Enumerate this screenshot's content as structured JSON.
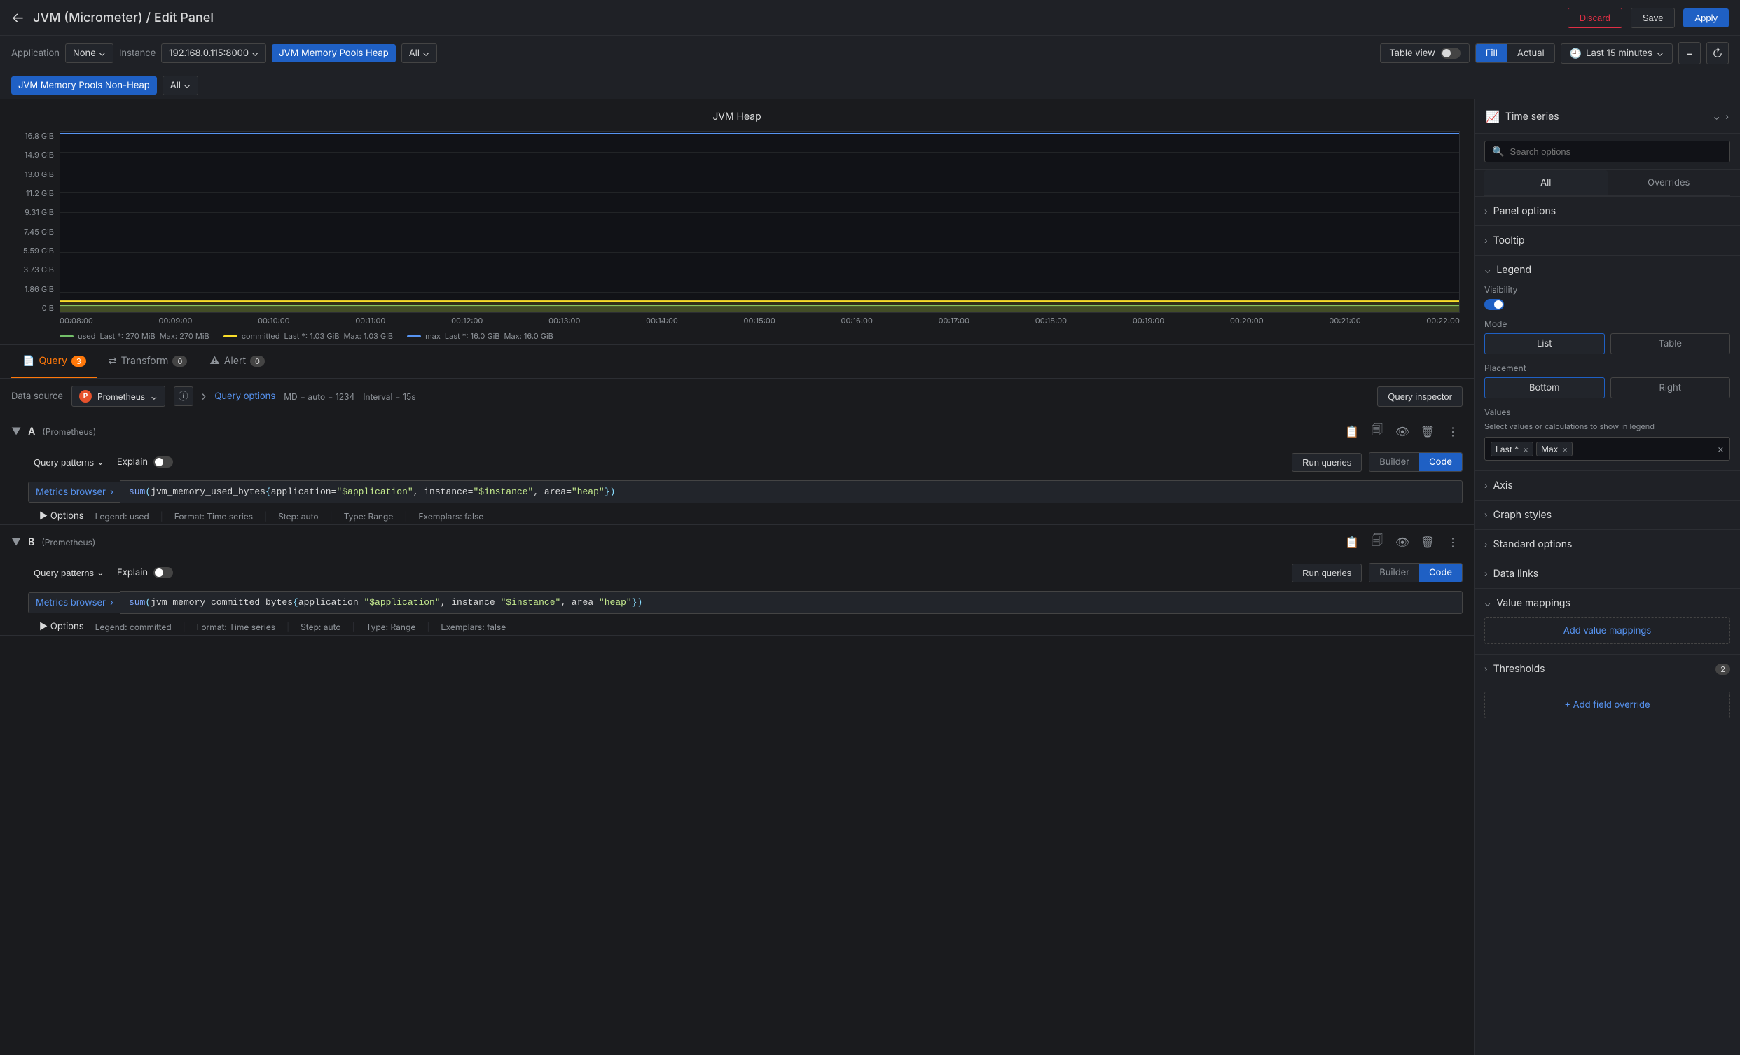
{
  "topbar": {
    "title": "JVM (Micrometer) / Edit Panel",
    "discard_label": "Discard",
    "save_label": "Save",
    "apply_label": "Apply"
  },
  "filterbar": {
    "application_label": "Application",
    "application_value": "None",
    "instance_label": "Instance",
    "instance_value": "192.168.0.115:8000",
    "memory_pools_heap_label": "JVM Memory Pools Heap",
    "memory_pools_heap_value": "All",
    "table_view_label": "Table view",
    "fill_label": "Fill",
    "actual_label": "Actual",
    "time_label": "Last 15 minutes",
    "memory_pools_nonheap_label": "JVM Memory Pools Non-Heap",
    "memory_pools_nonheap_value": "All"
  },
  "chart": {
    "title": "JVM Heap",
    "y_axis": [
      "16.8 GiB",
      "14.9 GiB",
      "13.0 GiB",
      "11.2 GiB",
      "9.31 GiB",
      "7.45 GiB",
      "5.59 GiB",
      "3.73 GiB",
      "1.86 GiB",
      "0 B"
    ],
    "x_axis": [
      "00:08:00",
      "00:09:00",
      "00:10:00",
      "00:11:00",
      "00:12:00",
      "00:13:00",
      "00:14:00",
      "00:15:00",
      "00:16:00",
      "00:17:00",
      "00:18:00",
      "00:19:00",
      "00:20:00",
      "00:21:00",
      "00:22:00"
    ],
    "legend": [
      {
        "color": "#73bf69",
        "label": "used",
        "last": "270 MiB",
        "max": "270 MiB"
      },
      {
        "color": "#fade2a",
        "label": "committed",
        "last": "1.03 GiB",
        "max": "1.03 GiB"
      },
      {
        "color": "#5794f2",
        "label": "max",
        "last": "16.0 GiB",
        "max": "16.0 GiB"
      }
    ]
  },
  "query_panel": {
    "tabs": [
      {
        "label": "Query",
        "count": "3",
        "icon": "query-icon"
      },
      {
        "label": "Transform",
        "count": "0",
        "icon": "transform-icon"
      },
      {
        "label": "Alert",
        "count": "0",
        "icon": "alert-icon"
      }
    ],
    "datasource": {
      "label": "Data source",
      "name": "Prometheus",
      "query_options_label": "Query options",
      "md_info": "MD = auto = 1234",
      "interval_info": "Interval = 15s",
      "inspector_label": "Query inspector"
    },
    "queries": [
      {
        "letter": "A",
        "source": "(Prometheus)",
        "query_patterns_label": "Query patterns",
        "explain_label": "Explain",
        "run_queries_label": "Run queries",
        "builder_label": "Builder",
        "code_label": "Code",
        "metrics_browser_label": "Metrics browser",
        "expression": "sum(jvm_memory_used_bytes{application=\"$application\", instance=\"$instance\", area=\"heap\"})",
        "options": {
          "legend": "Legend: used",
          "format": "Format: Time series",
          "step": "Step: auto",
          "type": "Type: Range",
          "exemplars": "Exemplars: false"
        }
      },
      {
        "letter": "B",
        "source": "(Prometheus)",
        "query_patterns_label": "Query patterns",
        "explain_label": "Explain",
        "run_queries_label": "Run queries",
        "builder_label": "Builder",
        "code_label": "Code",
        "metrics_browser_label": "Metrics browser",
        "expression": "sum(jvm_memory_committed_bytes{application=\"$application\", instance=\"$instance\", area=\"heap\"})",
        "options": {
          "legend": "Legend: committed",
          "format": "Format: Time series",
          "step": "Step: auto",
          "type": "Type: Range",
          "exemplars": "Exemplars: false"
        }
      }
    ]
  },
  "right_panel": {
    "header": {
      "icon": "time-series-icon",
      "title": "Time series"
    },
    "search_placeholder": "Search options",
    "tabs": [
      "All",
      "Overrides"
    ],
    "sections": [
      {
        "title": "Panel options",
        "expanded": false
      },
      {
        "title": "Tooltip",
        "expanded": false
      },
      {
        "title": "Legend",
        "expanded": true,
        "fields": {
          "visibility_label": "Visibility",
          "mode_label": "Mode",
          "mode_options": [
            "List",
            "Table"
          ],
          "placement_label": "Placement",
          "placement_options": [
            "Bottom",
            "Right"
          ],
          "values_label": "Values",
          "values_desc": "Select values or calculations to show in legend",
          "values_chips": [
            "Last *",
            "Max"
          ]
        }
      },
      {
        "title": "Axis",
        "expanded": false
      },
      {
        "title": "Graph styles",
        "expanded": false
      },
      {
        "title": "Standard options",
        "expanded": false
      },
      {
        "title": "Data links",
        "expanded": false
      },
      {
        "title": "Value mappings",
        "expanded": true,
        "add_label": "Add value mappings"
      },
      {
        "title": "Thresholds",
        "expanded": false,
        "badge": "2"
      },
      {
        "title": "Add field override",
        "add_label": "+ Add field override",
        "is_add": true
      }
    ]
  }
}
